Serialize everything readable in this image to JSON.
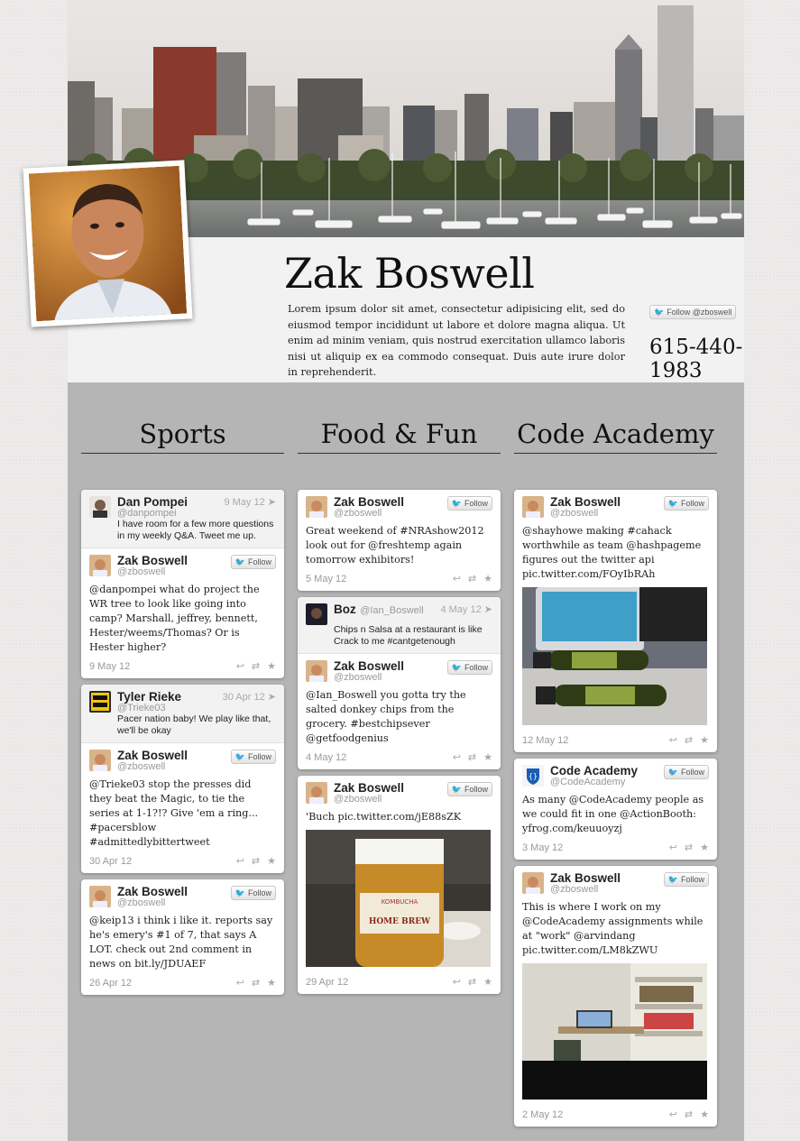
{
  "profile": {
    "name": "Zak Boswell",
    "bio": "Lorem ipsum dolor sit amet, consectetur adipisicing elit, sed do eiusmod tempor incididunt ut labore et dolore magna aliqua. Ut enim ad minim veniam, quis nostrud exercitation ullamco laboris nisi ut aliquip ex ea commodo consequat. Duis aute irure dolor in reprehenderit.",
    "follow_label": "Follow @zboswell",
    "phone": "615-440-1983"
  },
  "columns": [
    {
      "title": "Sports"
    },
    {
      "title": "Food & Fun"
    },
    {
      "title": "Code Academy"
    }
  ],
  "follow": "Follow",
  "sports": {
    "c1_reply": {
      "name": "Dan Pompei",
      "handle": "@danpompei",
      "date": "9 May 12",
      "text": "I have room for a few more questions in my weekly Q&A. Tweet me up."
    },
    "c1_tweet": {
      "name": "Zak Boswell",
      "handle": "@zboswell",
      "text": "@danpompei what do project the WR tree to look like going into camp? Marshall, jeffrey, bennett, Hester/weems/Thomas? Or is Hester higher?",
      "date": "9 May 12"
    },
    "c2_reply": {
      "name": "Tyler Rieke",
      "handle": "@Trieke03",
      "date": "30 Apr 12",
      "text": "Pacer nation baby! We play like that, we'll be okay"
    },
    "c2_tweet": {
      "name": "Zak Boswell",
      "handle": "@zboswell",
      "text": "@Trieke03 stop the presses did they beat the Magic, to tie the series at 1-1?!? Give 'em a ring... #pacersblow #admittedlybittertweet",
      "date": "30 Apr 12"
    },
    "c3_tweet": {
      "name": "Zak Boswell",
      "handle": "@zboswell",
      "text": "@keip13 i think i like it. reports say he's emery's #1 of 7, that says A LOT. check out 2nd comment in news on bit.ly/JDUAEF",
      "date": "26 Apr 12"
    }
  },
  "food": {
    "c1_tweet": {
      "name": "Zak Boswell",
      "handle": "@zboswell",
      "text": "Great weekend of #NRAshow2012 look out for @freshtemp again tomorrow exhibitors!",
      "date": "5 May 12"
    },
    "c2_reply": {
      "name": "Boz",
      "handle": "@Ian_Boswell",
      "date": "4 May 12",
      "text": "Chips n Salsa at a restaurant is like Crack to me #cantgetenough"
    },
    "c2_tweet": {
      "name": "Zak Boswell",
      "handle": "@zboswell",
      "text": "@Ian_Boswell you gotta try the salted donkey chips from the grocery. #bestchipsever @getfoodgenius",
      "date": "4 May 12"
    },
    "c3_tweet": {
      "name": "Zak Boswell",
      "handle": "@zboswell",
      "text": "'Buch pic.twitter.com/jE88sZK",
      "date": "29 Apr 12",
      "jar_label_1": "KOMBUCHA",
      "jar_label_2": "HOME BREW"
    }
  },
  "code": {
    "c1_tweet": {
      "name": "Zak Boswell",
      "handle": "@zboswell",
      "text": "@shayhowe making #cahack worthwhile as team @hashpageme figures out the twitter api pic.twitter.com/FOyIbRAh",
      "date": "12 May 12"
    },
    "c2_tweet": {
      "name": "Code Academy",
      "handle": "@CodeAcademy",
      "text": "As many @CodeAcademy people as we could fit in one @ActionBooth: yfrog.com/keuuoyzj",
      "date": "3 May 12"
    },
    "c3_tweet": {
      "name": "Zak Boswell",
      "handle": "@zboswell",
      "text": "This is where I work on my @CodeAcademy assignments while at \"work\" @arvindang pic.twitter.com/LM8kZWU",
      "date": "2 May 12"
    }
  },
  "icons": {
    "reply": "reply-icon",
    "retweet": "retweet-icon",
    "favorite": "star-icon",
    "bird": "twitter-bird-icon"
  }
}
